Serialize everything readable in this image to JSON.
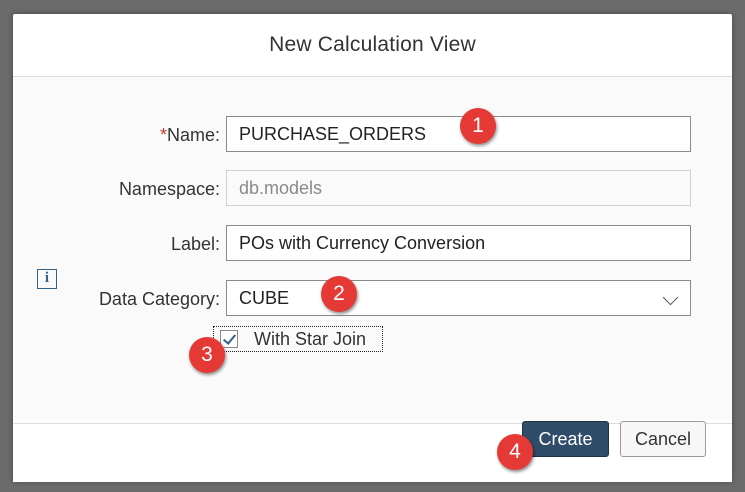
{
  "dialog": {
    "title": "New Calculation View"
  },
  "form": {
    "name": {
      "required_mark": "*",
      "label": "Name:",
      "value": "PURCHASE_ORDERS"
    },
    "namespace": {
      "label": "Namespace:",
      "value": "db.models"
    },
    "label": {
      "label": "Label:",
      "value": "POs with Currency Conversion"
    },
    "data_category": {
      "label": "Data Category:",
      "value": "CUBE"
    },
    "star_join": {
      "label": "With Star Join",
      "checked": true
    }
  },
  "footer": {
    "create_label": "Create",
    "cancel_label": "Cancel"
  },
  "callouts": [
    "1",
    "2",
    "3",
    "4"
  ],
  "colors": {
    "accent": "#2f4c68",
    "badge": "#e53935",
    "required": "#c0392b"
  },
  "icons": {
    "info": "info-icon",
    "dropdown": "chevron-down-icon",
    "check": "check-icon"
  }
}
